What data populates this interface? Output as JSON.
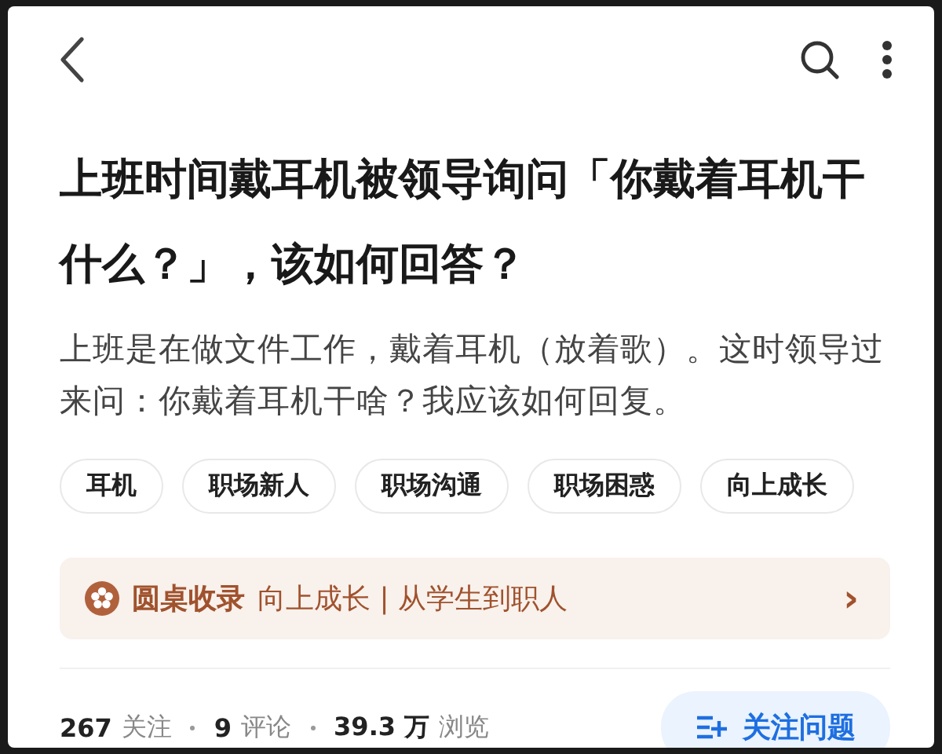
{
  "title": "上班时间戴耳机被领导询问「你戴着耳机干什么？」，该如何回答？",
  "description": "上班是在做文件工作，戴着耳机（放着歌）。这时领导过来问：你戴着耳机干啥？我应该如何回复。",
  "tags": [
    "耳机",
    "职场新人",
    "职场沟通",
    "职场困惑",
    "向上成长"
  ],
  "roundtable": {
    "label": "圆桌收录",
    "name": "向上成长 | 从学生到职人",
    "arrow": "›"
  },
  "stats": [
    {
      "count": "267",
      "label": "关注"
    },
    {
      "count": "9",
      "label": "评论"
    },
    {
      "count": "39.3 万",
      "label": "浏览"
    }
  ],
  "follow_button": "关注问题"
}
